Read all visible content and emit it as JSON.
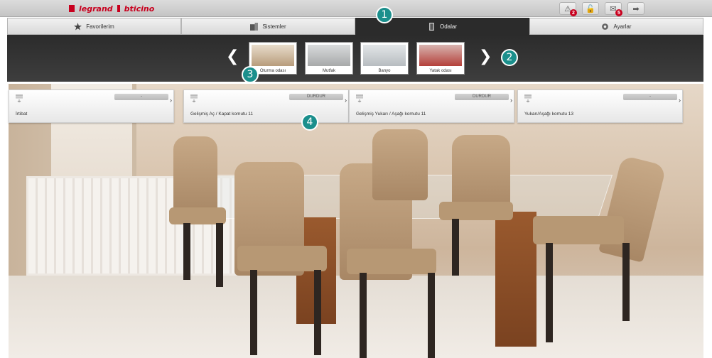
{
  "brand": {
    "left": "legrand",
    "right": "bticino"
  },
  "header_icons": [
    {
      "icon": "warning-icon",
      "badge": "2"
    },
    {
      "icon": "lock-icon",
      "badge": ""
    },
    {
      "icon": "mail-icon",
      "badge": "5"
    },
    {
      "icon": "logout-icon",
      "badge": ""
    }
  ],
  "tabs": [
    {
      "label": "Favorilerim",
      "icon": "star-icon",
      "active": false
    },
    {
      "label": "Sistemler",
      "icon": "systems-icon",
      "active": false
    },
    {
      "label": "Odalar",
      "icon": "rooms-icon",
      "active": true
    },
    {
      "label": "Ayarlar",
      "icon": "settings-icon",
      "active": false
    }
  ],
  "rooms": [
    {
      "label": "Oturma odası"
    },
    {
      "label": "Mutfak"
    },
    {
      "label": "Banyo"
    },
    {
      "label": "Yatak odası"
    }
  ],
  "devices": [
    {
      "name": "İrtibat",
      "state": "-"
    },
    {
      "name": "Gelişmiş Aç / Kapat komutu 11",
      "state": "DURDUR"
    },
    {
      "name": "Gelişmiş Yukarı / Aşağı komutu 11",
      "state": "DURDUR"
    },
    {
      "name": "Yukarı/Aşağı komutu 13",
      "state": "-"
    }
  ],
  "callouts": [
    "1",
    "2",
    "3",
    "4"
  ],
  "colors": {
    "brand_red": "#c8001e",
    "callout": "#1b8f8c",
    "dark_bar": "#2b2b2b"
  }
}
